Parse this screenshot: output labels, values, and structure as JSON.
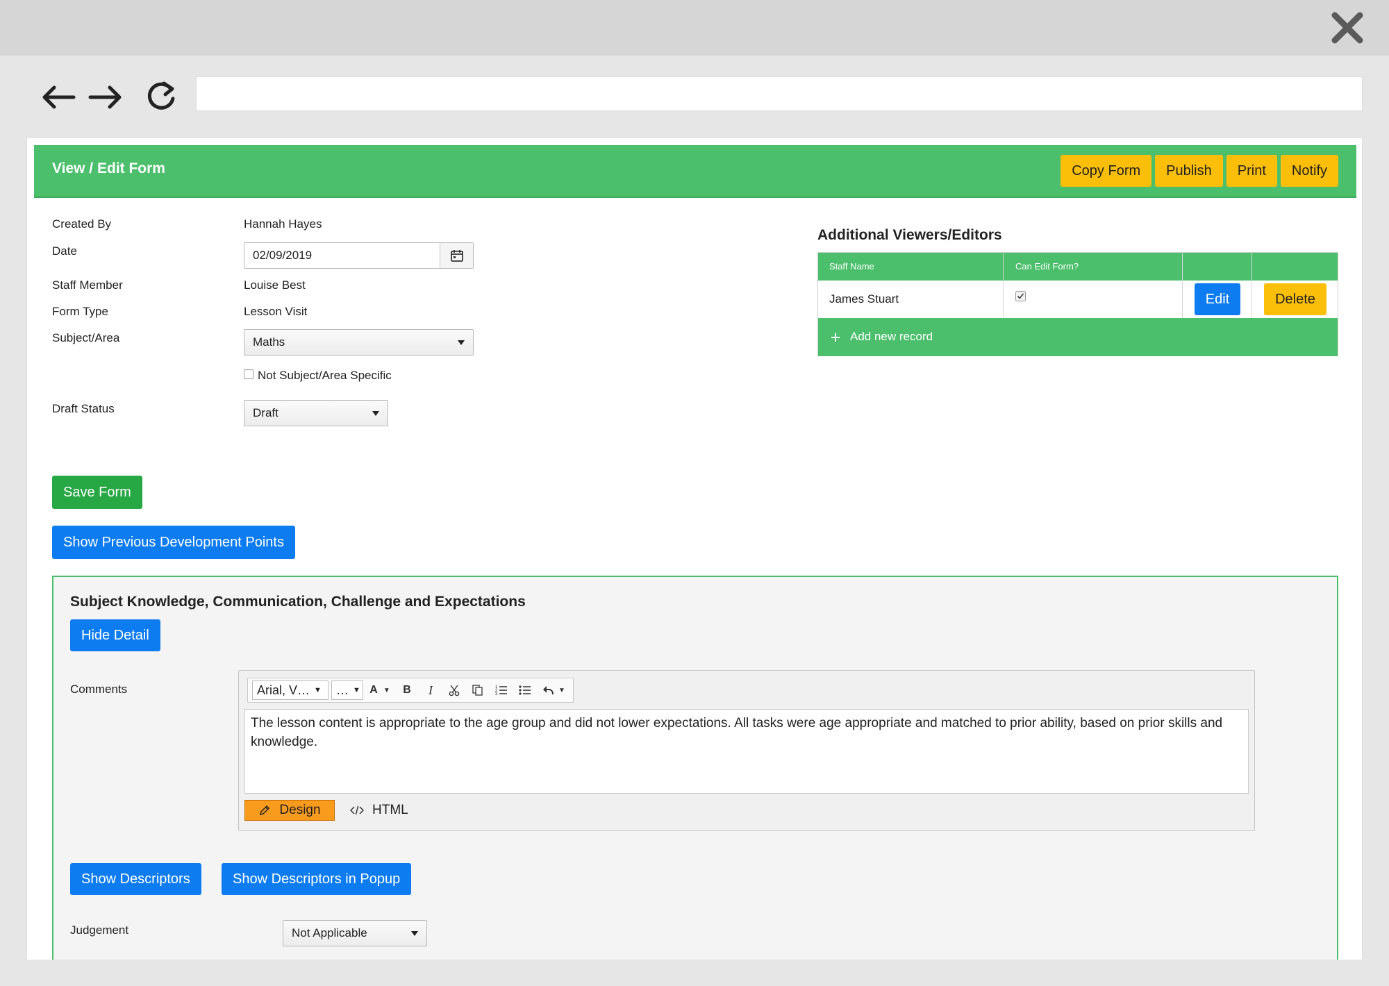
{
  "browser": {
    "close_icon": "close-icon",
    "back_icon": "arrow-left-icon",
    "forward_icon": "arrow-right-icon",
    "reload_icon": "reload-icon",
    "url": ""
  },
  "header": {
    "title": "View / Edit Form",
    "buttons": [
      "Copy Form",
      "Publish",
      "Print",
      "Notify"
    ]
  },
  "form": {
    "created_by_label": "Created By",
    "created_by_value": "Hannah Hayes",
    "date_label": "Date",
    "date_value": "02/09/2019",
    "staff_member_label": "Staff Member",
    "staff_member_value": "Louise Best",
    "form_type_label": "Form Type",
    "form_type_value": "Lesson Visit",
    "subject_label": "Subject/Area",
    "subject_value": "Maths",
    "not_subject_specific_label": "Not Subject/Area Specific",
    "not_subject_specific_checked": false,
    "draft_status_label": "Draft Status",
    "draft_status_value": "Draft",
    "save_button": "Save Form",
    "show_previous_button": "Show Previous Development Points"
  },
  "viewers": {
    "title": "Additional Viewers/Editors",
    "columns": [
      "Staff Name",
      "Can Edit Form?"
    ],
    "rows": [
      {
        "staff_name": "James Stuart",
        "can_edit": true,
        "edit_label": "Edit",
        "delete_label": "Delete"
      }
    ],
    "add_new_label": "Add new record"
  },
  "section": {
    "title": "Subject Knowledge, Communication, Challenge and Expectations",
    "hide_detail_button": "Hide Detail",
    "comments_label": "Comments",
    "editor": {
      "font_select": "Arial, V…",
      "size_select": "…",
      "comment_text": "The lesson content is appropriate to the age group and did not lower expectations. All tasks were age appropriate and matched to prior ability, based on prior skills and knowledge.",
      "design_label": "Design",
      "html_label": "HTML"
    },
    "show_descriptors_button": "Show Descriptors",
    "show_descriptors_popup_button": "Show Descriptors in Popup",
    "judgement_label": "Judgement",
    "judgement_value": "Not Applicable"
  },
  "colors": {
    "header_green": "#4cbf6c",
    "button_yellow": "#fbbf0a",
    "button_blue": "#0d7cf0",
    "button_green": "#28a745",
    "design_orange": "#f99b1d"
  }
}
